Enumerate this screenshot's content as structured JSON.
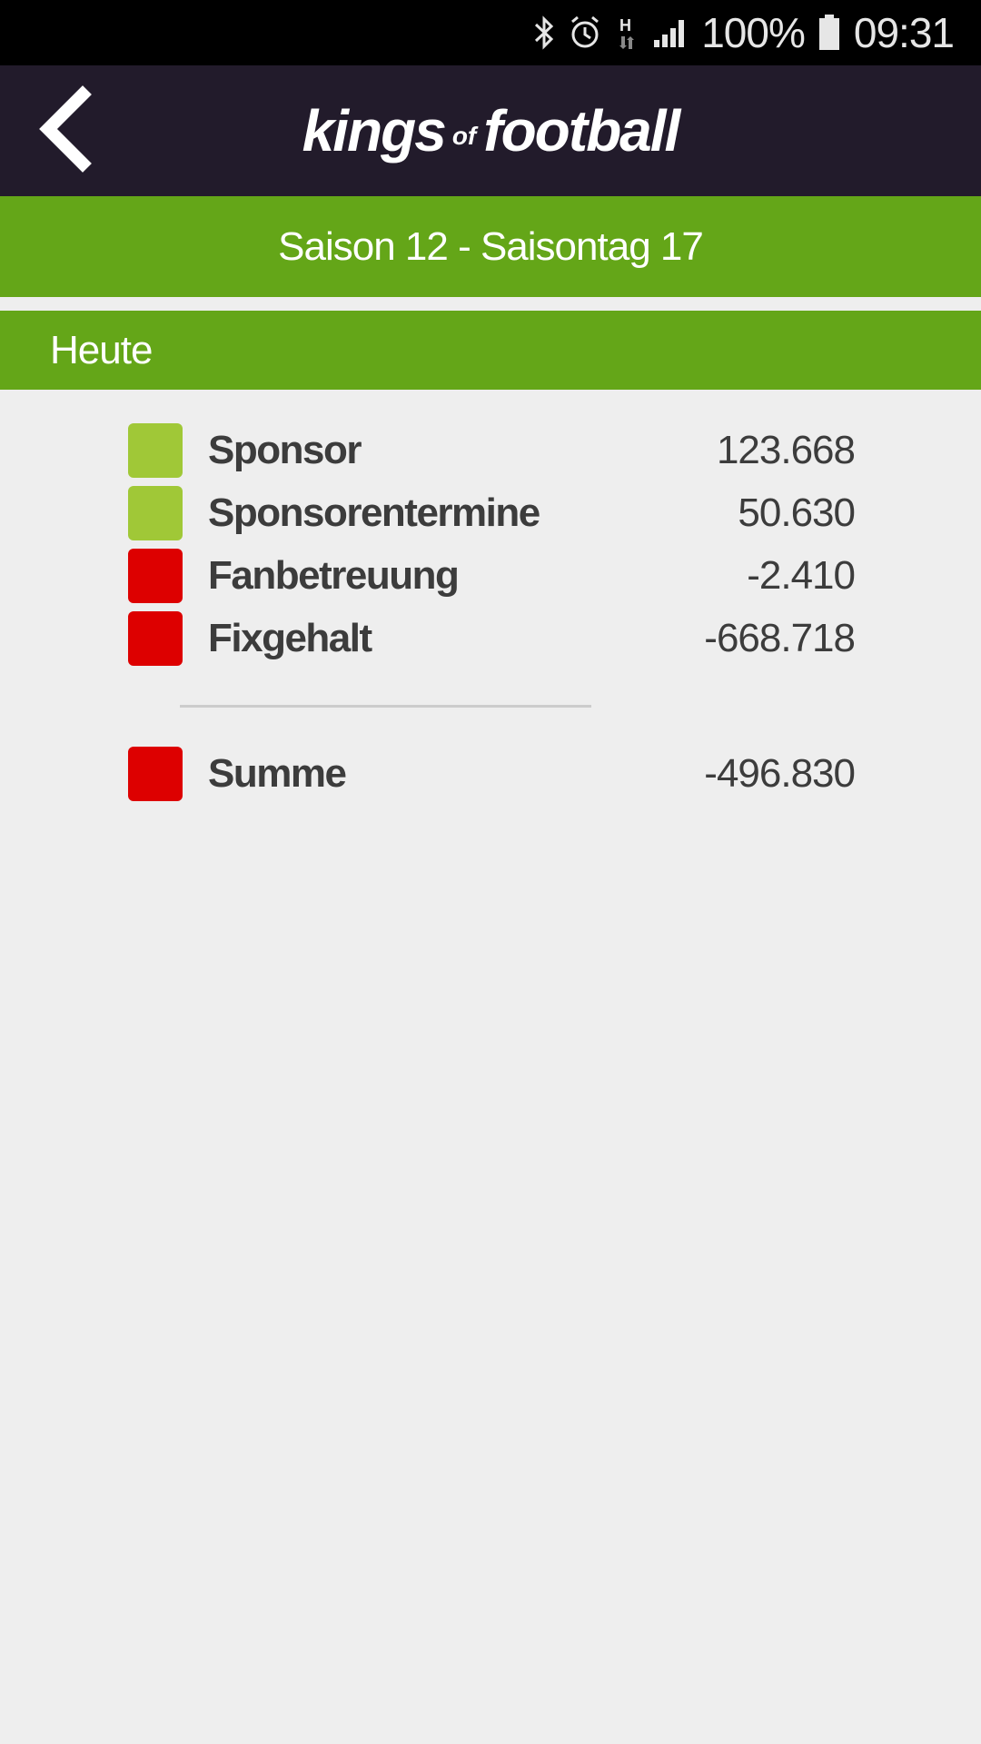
{
  "status_bar": {
    "battery_percent": "100%",
    "time": "09:31",
    "icons": [
      "bluetooth-icon",
      "alarm-icon",
      "hspa-data-icon",
      "signal-icon",
      "battery-icon"
    ]
  },
  "header": {
    "logo": {
      "part1": "kings",
      "part2": "of",
      "part3": "football"
    },
    "back_icon": "chevron-left-icon"
  },
  "season_bar": {
    "text": "Saison 12 - Saisontag 17"
  },
  "section": {
    "title": "Heute"
  },
  "rows": [
    {
      "label": "Sponsor",
      "value": "123.668",
      "color": "#a0c837"
    },
    {
      "label": "Sponsorentermine",
      "value": "50.630",
      "color": "#a0c837"
    },
    {
      "label": "Fanbetreuung",
      "value": "-2.410",
      "color": "#dd0000"
    },
    {
      "label": "Fixgehalt",
      "value": "-668.718",
      "color": "#dd0000"
    }
  ],
  "total": {
    "label": "Summe",
    "value": "-496.830",
    "color": "#dd0000"
  },
  "colors": {
    "header_bg": "#221b2b",
    "accent_green": "#64a618",
    "positive": "#a0c837",
    "negative": "#dd0000",
    "page_bg": "#eeeeee"
  }
}
